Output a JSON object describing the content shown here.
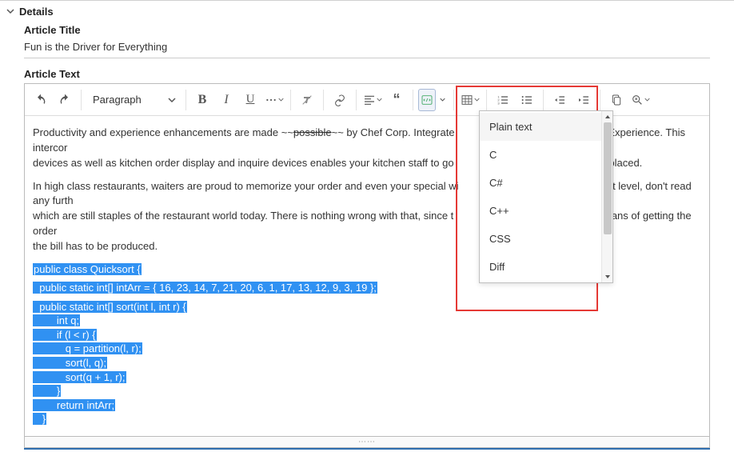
{
  "details": {
    "heading": "Details"
  },
  "title_field": {
    "label": "Article Title",
    "value": "Fun is the Driver for Everything"
  },
  "text_field": {
    "label": "Article Text"
  },
  "toolbar": {
    "format": "Paragraph"
  },
  "content": {
    "p1a": "Productivity and experience enhancements are made ~~",
    "p1strike": "possible",
    "p1b": "~~ by Chef Corp. Integrate",
    "p1c": "uest Experience. This intercor",
    "p1d": "devices as well as kitchen order display and inquire devices enables your kitchen staff to go",
    "p1e": "eing placed.",
    "p2a": "In high class restaurants, waiters are proud to memorize your order and even your special wi",
    "p2b": "n that level, don't read any furth",
    "p2c": "which are still staples of the restaurant world today. There is nothing wrong with that, since t",
    "p2d": "tive means of getting the order",
    "p2e": "the bill has to be produced."
  },
  "code": {
    "l1": "public class Quicksort {",
    "l2": "  public static int[] intArr = { 16, 23, 14, 7, 21, 20, 6, 1, 17, 13, 12, 9, 3, 19 };",
    "l3": "  public static int[] sort(int l, int r) {",
    "l4": "        int q;",
    "l5": "        if (l < r) {",
    "l6": "           q = partition(l, r);",
    "l7": "           sort(l, q);",
    "l8": "           sort(q + 1, r);",
    "l9": "        }",
    "l10": "        return intArr;",
    "l11": "   }"
  },
  "dropdown": {
    "items": [
      "Plain text",
      "C",
      "C#",
      "C++",
      "CSS",
      "Diff"
    ]
  }
}
